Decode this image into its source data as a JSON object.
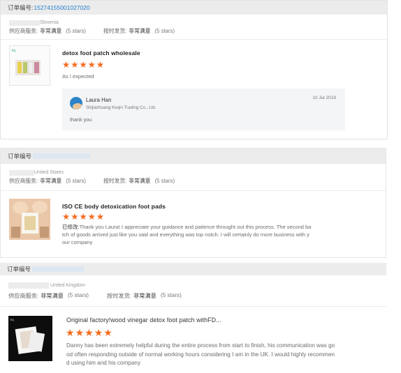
{
  "orders": [
    {
      "order_label": "订单编号:",
      "order_no": "15274155001027020",
      "country": "Slovenia",
      "supplier_service_label": "供应商服务:",
      "supplier_service_value": "非常满意",
      "supplier_service_stars": "(5 stars)",
      "ship_on_time_label": "按时发货:",
      "ship_on_time_value": "非常满意",
      "ship_on_time_stars": "(5 stars)",
      "product_title": "detox foot patch wholesale",
      "rating": 5,
      "review_text": "As I expected",
      "reply": {
        "name": "Laura Han",
        "company": "Shijiazhuang Keqin Trading Co., Ltd.",
        "date": "10 Jul 2019",
        "text": "thank you"
      }
    },
    {
      "order_label": "订单编号",
      "country": "United States",
      "supplier_service_label": "供应商服务:",
      "supplier_service_value": "非常满意",
      "supplier_service_stars": "(5 stars)",
      "ship_on_time_label": "按时发货:",
      "ship_on_time_value": "非常满意",
      "ship_on_time_stars": "(5 stars)",
      "product_title": "ISO CE body detoxication foot pads",
      "rating": 5,
      "modified_label": "已修改:",
      "review_line1": "Thank you Laura! I appreciate your guidance and patience throught out this process. The second ba",
      "review_line2": "tch of goods arrived just like you said and everything was top notch. I will certainly do more business with y",
      "review_line3": "our company"
    },
    {
      "order_label": "订单编号",
      "country": "United Kingdom",
      "supplier_service_label": "供应商服务:",
      "supplier_service_value": "非常满意",
      "supplier_service_stars": "(5 stars)",
      "ship_on_time_label": "按时发货:",
      "ship_on_time_value": "非常满意",
      "ship_on_time_stars": "(5 stars)",
      "product_title": "Original factory!wood vinegar detox foot patch withFD...",
      "rating": 5,
      "review_line1": "Danny has been extremely helpful during the entire process from start to finish, his communication was go",
      "review_line2": "od often responding outside of normal working hours considering I am in the UK. I would highly recommen",
      "review_line3": "d using him and his company"
    }
  ],
  "colors": {
    "star": "#f46b1d",
    "order_no": "#1f7fd0",
    "bar_bg": "#ececec"
  },
  "icons": {
    "star": "star-icon",
    "avatar": "avatar"
  }
}
